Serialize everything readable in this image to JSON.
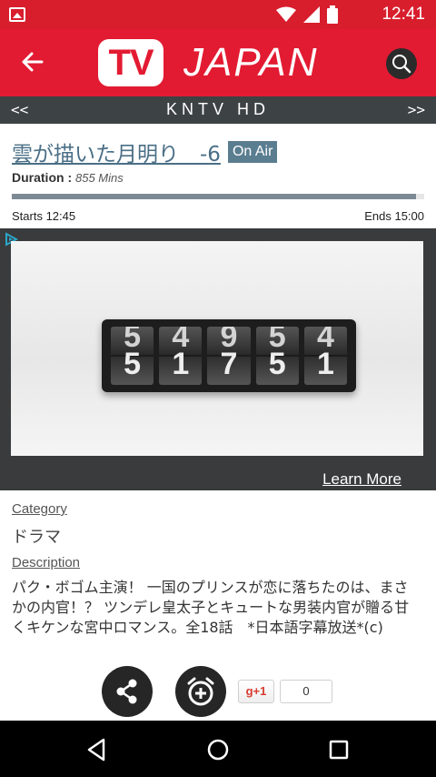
{
  "status_bar": {
    "time": "12:41"
  },
  "app_bar": {
    "logo_tv": "TV",
    "logo_text": "JAPAN"
  },
  "channel": {
    "prev": "<<",
    "name": "KNTV HD",
    "next": ">>"
  },
  "program": {
    "title": "雲が描いた月明り　-6",
    "status_badge": "On Air",
    "duration_label": "Duration :",
    "duration_value": "855 Mins",
    "starts": "Starts 12:45",
    "ends": "Ends 15:00",
    "progress": 0.98
  },
  "ad": {
    "counter_top_digits": [
      "5",
      "4",
      "9",
      "5",
      "4"
    ],
    "counter_bottom_digits": [
      "5",
      "1",
      "7",
      "5",
      "1"
    ],
    "learn_more": "Learn More"
  },
  "details": {
    "category_label": "Category",
    "category_value": "ドラマ",
    "description_label": "Description",
    "description": "パク・ボゴム主演！ 一国のプリンスが恋に落ちたのは、まさかの内官！？ ツンデレ皇太子とキュートな男装内官が贈る甘くキケンな宮中ロマンス。全18話　*日本語字幕放送*(c)"
  },
  "actions": {
    "gplus_label": "g+1",
    "gplus_count": "0"
  },
  "icons": {
    "back": "arrow-left-icon",
    "search": "search-icon",
    "share": "share-icon",
    "alarm": "alarm-add-icon",
    "adchoices": "adchoices-icon"
  },
  "colors": {
    "brand_red": "#e21b32",
    "status_red": "#d81e2d",
    "title_blue": "#4a6f86",
    "badge": "#5a7d90"
  }
}
